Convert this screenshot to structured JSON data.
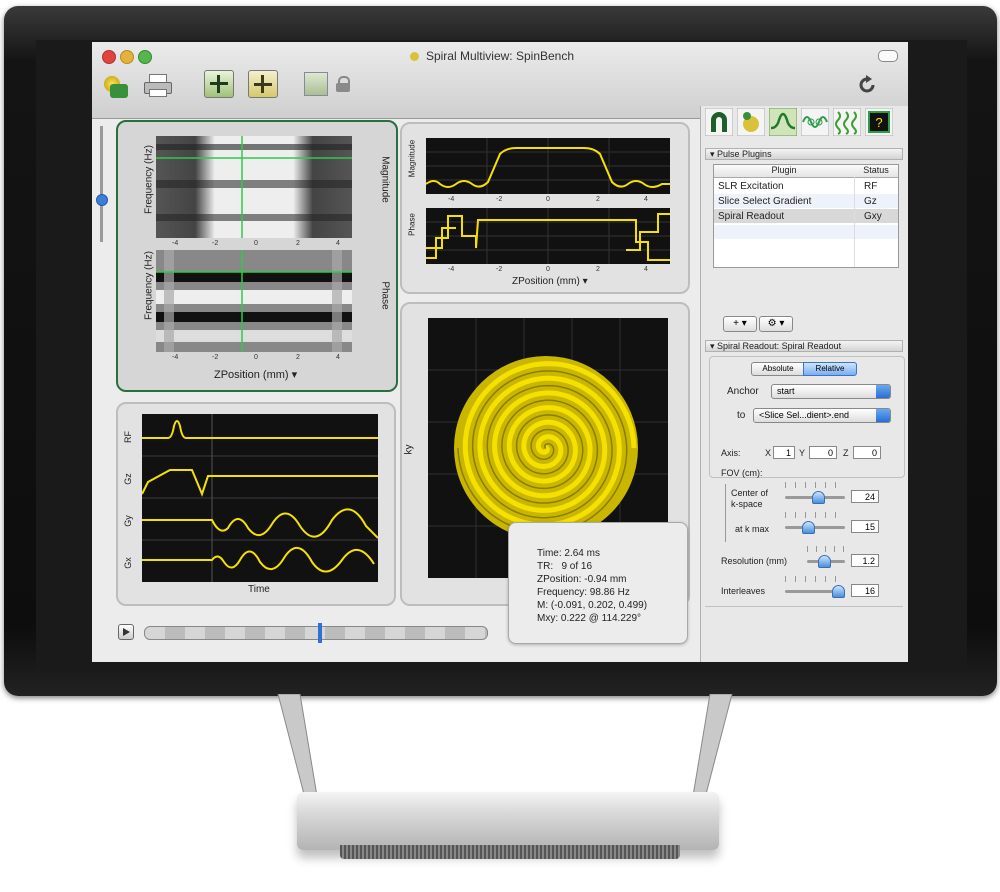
{
  "window": {
    "title": "Spiral Multiview: SpinBench"
  },
  "toolbar": {
    "app_icon_text": "SpinBench"
  },
  "magnitude_panel": {
    "ylabel_top": "Frequency (Hz)",
    "ylabel_bottom": "Frequency (Hz)",
    "right_label_top": "Magnitude",
    "right_label_bottom": "Phase",
    "xlabel": "ZPosition (mm)",
    "xticks": [
      "-4",
      "-2",
      "0",
      "2",
      "4"
    ]
  },
  "profile_panel": {
    "ylabel_top": "Magnitude",
    "ylabel_bottom": "Phase",
    "xlabel": "ZPosition (mm)",
    "xticks": [
      "-4",
      "-2",
      "0",
      "2",
      "4"
    ]
  },
  "sequence_panel": {
    "channels": [
      "RF",
      "Gz",
      "Gy",
      "Gx"
    ],
    "xlabel": "Time"
  },
  "kspace_panel": {
    "ylabel": "ky"
  },
  "info_box": {
    "time": "Time: 2.64 ms",
    "tr": "TR:   9 of 16",
    "zposition": "ZPosition: -0.94 mm",
    "frequency": "Frequency: 98.86 Hz",
    "m": "M: (-0.091, 0.202, 0.499)",
    "mxy": "Mxy: 0.222 @ 114.229°"
  },
  "sidebar": {
    "pulse_plugins_header": "Pulse Plugins",
    "table_headers": [
      "Plugin",
      "Status"
    ],
    "plugins": [
      {
        "name": "SLR Excitation",
        "status": "RF"
      },
      {
        "name": "Slice Select Gradient",
        "status": "Gz"
      },
      {
        "name": "Spiral Readout",
        "status": "Gxy"
      }
    ],
    "add_menu": "+",
    "readout_header": "Spiral Readout: Spiral Readout",
    "seg_absolute": "Absolute",
    "seg_relative": "Relative",
    "anchor_label": "Anchor",
    "anchor_value": "start",
    "to_label": "to",
    "to_value": "<Slice Sel...dient>.end",
    "axis_label": "Axis:",
    "axis_x_label": "X",
    "axis_x": "1",
    "axis_y_label": "Y",
    "axis_y": "0",
    "axis_z_label": "Z",
    "axis_z": "0",
    "fov_label": "FOV (cm):",
    "center_label_1": "Center of",
    "center_label_2": "k-space",
    "center_value": "24",
    "kmax_label": "at k max",
    "kmax_value": "15",
    "resolution_label": "Resolution (mm)",
    "resolution_value": "1.2",
    "interleaves_label": "Interleaves",
    "interleaves_value": "16",
    "slider_levels": {
      "center": 0.55,
      "kmax": 0.35,
      "resolution": 0.4,
      "interleaves": 0.95
    }
  },
  "timeline": {
    "position": 0.51
  },
  "colors": {
    "trace": "#f5e100",
    "accent_green": "#2a6f3e",
    "plot_bg": "#111111"
  }
}
